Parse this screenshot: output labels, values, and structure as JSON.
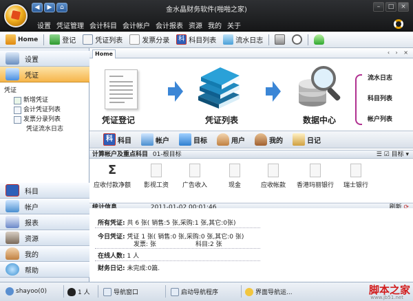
{
  "window": {
    "title": "金水晶财务软件(啪啪之家)",
    "menu": [
      "设置",
      "凭证管理",
      "会计科目",
      "会计帐户",
      "会计报表",
      "资源",
      "我的",
      "关于"
    ]
  },
  "toolbar": {
    "items": [
      {
        "label": "Home",
        "icon": "home-icon",
        "color": "#e8a020"
      },
      {
        "label": "登记",
        "icon": "add-voucher-icon",
        "color": "#3aa53a"
      },
      {
        "label": "凭证列表",
        "icon": "voucher-list-icon",
        "color": "#5577aa"
      },
      {
        "label": "发票分录",
        "icon": "invoice-icon",
        "color": "#888888"
      },
      {
        "label": "科目列表",
        "icon": "account-icon",
        "color": "#3366cc"
      },
      {
        "label": "流水日志",
        "icon": "journal-icon",
        "color": "#55a0d0"
      },
      {
        "label": "",
        "icon": "calculator-icon",
        "color": "#777777"
      },
      {
        "label": "",
        "icon": "clock-icon",
        "color": "#666666"
      },
      {
        "label": "",
        "icon": "exit-icon",
        "color": "#33aa33"
      }
    ]
  },
  "leftnav": {
    "top_items": [
      {
        "label": "设置",
        "icon": "settings-icon",
        "color": "#6a8fc0"
      },
      {
        "label": "凭证",
        "icon": "voucher-icon",
        "color": "#4a8fe0"
      }
    ],
    "tree_root": "凭证",
    "tree_items": [
      {
        "label": "新增凭证",
        "icon": "new-voucher-icon"
      },
      {
        "label": "会计凭证列表",
        "icon": "voucher-list-icon"
      },
      {
        "label": "发票分录列表",
        "icon": "invoice-list-icon"
      },
      {
        "label": "凭证流水日志",
        "icon": ""
      }
    ],
    "bottom_items": [
      {
        "label": "科目",
        "icon": "subject-icon",
        "color": "#3366cc"
      },
      {
        "label": "帐户",
        "icon": "account-book-icon",
        "color": "#4a8fd0"
      },
      {
        "label": "报表",
        "icon": "report-icon",
        "color": "#6a88c8"
      },
      {
        "label": "资源",
        "icon": "tools-icon",
        "color": "#7a6a5a"
      },
      {
        "label": "我的",
        "icon": "user-icon",
        "color": "#c08040"
      },
      {
        "label": "帮助",
        "icon": "help-icon",
        "color": "#3a8fd0"
      }
    ]
  },
  "main": {
    "tab": "Home",
    "tab_nav": "‹ › ×",
    "flow": [
      {
        "label": "凭证登记",
        "icon": "voucher-form-icon"
      },
      {
        "label": "凭证列表",
        "icon": "books-icon"
      },
      {
        "label": "数据中心",
        "icon": "database-search-icon"
      }
    ],
    "side_links": [
      "流水日志",
      "科目列表",
      "帐户列表"
    ],
    "quick_buttons": [
      {
        "label": "科目",
        "icon": "subject-icon",
        "color": "#3366cc"
      },
      {
        "label": "帐户",
        "icon": "account-book-icon",
        "color": "#4a8fd0"
      },
      {
        "label": "目标",
        "icon": "target-icon",
        "color": "#2f7fd0"
      },
      {
        "label": "用户",
        "icon": "users-icon",
        "color": "#c08040"
      },
      {
        "label": "我的",
        "icon": "my-icon",
        "color": "#a06030"
      },
      {
        "label": "日记",
        "icon": "diary-icon",
        "color": "#d0a040"
      }
    ],
    "accounts_header": {
      "title": "计算帐户及重点科目",
      "subtitle": "01-根目标",
      "right": "目标"
    },
    "accounts": [
      {
        "label": "应收付款净额",
        "icon": "sigma-icon"
      },
      {
        "label": "影视工资",
        "icon": "doc-icon"
      },
      {
        "label": "广告收入",
        "icon": "doc-icon"
      },
      {
        "label": "现金",
        "icon": "doc-icon"
      },
      {
        "label": "应收帐款",
        "icon": "doc-icon"
      },
      {
        "label": "香港玛丽银行",
        "icon": "doc-icon"
      },
      {
        "label": "瑞士银行",
        "icon": "doc-icon"
      }
    ],
    "stats_header": {
      "title": "统计信息",
      "datetime": "2011-01-02 00:01:46",
      "refresh": "刷新"
    },
    "stats": {
      "all_label": "所有凭证:",
      "all_value": "共 6 张( 销售:5 张,采购:1 张,其它:0张)",
      "today_label": "今日凭证:",
      "today_value": "凭证 1 张( 销售:0 张,采购:0 张,其它:0 张)",
      "today_invoice": "发票: 张",
      "today_subject": "科目:2 张",
      "online_label": "在线人数:",
      "online_value": "1 人",
      "journal_label": "财务日记:",
      "journal_value": "未完成:0篇."
    }
  },
  "statusbar": {
    "user": "shayoo(0)",
    "online": "1 人",
    "nav_window": "导航窗口",
    "start_nav": "启动导航程序",
    "ui_nav": "界面导航运..."
  },
  "watermark": {
    "text": "脚本之家",
    "url": "www.jb51.net"
  }
}
